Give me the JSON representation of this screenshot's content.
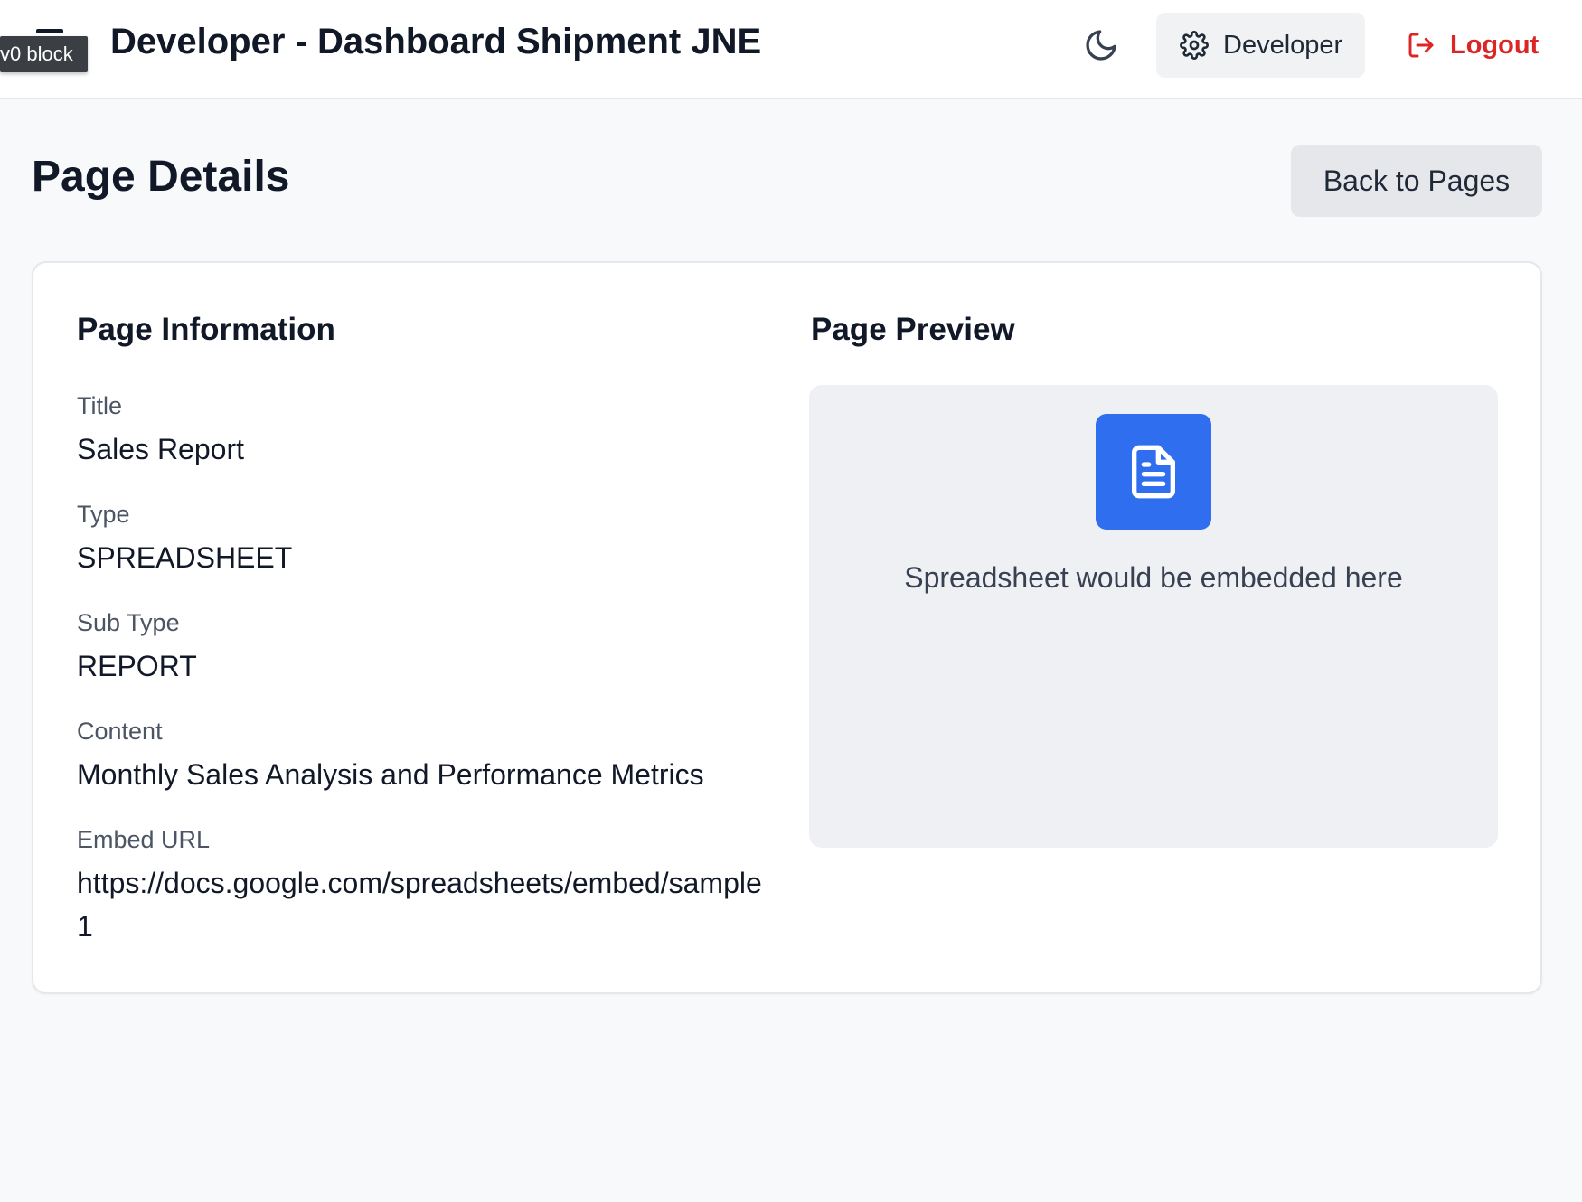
{
  "topbar": {
    "badge": "v0 block",
    "app_title": "Developer - Dashboard Shipment JNE",
    "role_button": "Developer",
    "logout_button": "Logout",
    "icons": {
      "menu": "menu-icon",
      "theme": "moon-icon",
      "role": "gear-icon",
      "logout": "logout-icon"
    }
  },
  "page": {
    "title": "Page Details",
    "back_button": "Back to Pages"
  },
  "info": {
    "heading": "Page Information",
    "fields": [
      {
        "label": "Title",
        "value": "Sales Report"
      },
      {
        "label": "Type",
        "value": "SPREADSHEET"
      },
      {
        "label": "Sub Type",
        "value": "REPORT"
      },
      {
        "label": "Content",
        "value": "Monthly Sales Analysis and Performance Metrics"
      },
      {
        "label": "Embed URL",
        "value": "https://docs.google.com/spreadsheets/embed/sample1"
      }
    ]
  },
  "preview": {
    "heading": "Page Preview",
    "placeholder": "Spreadsheet would be embedded here",
    "icon": "document-icon"
  },
  "colors": {
    "accent": "#2f6fef",
    "danger": "#dc2626",
    "background": "#f8f9fb"
  }
}
